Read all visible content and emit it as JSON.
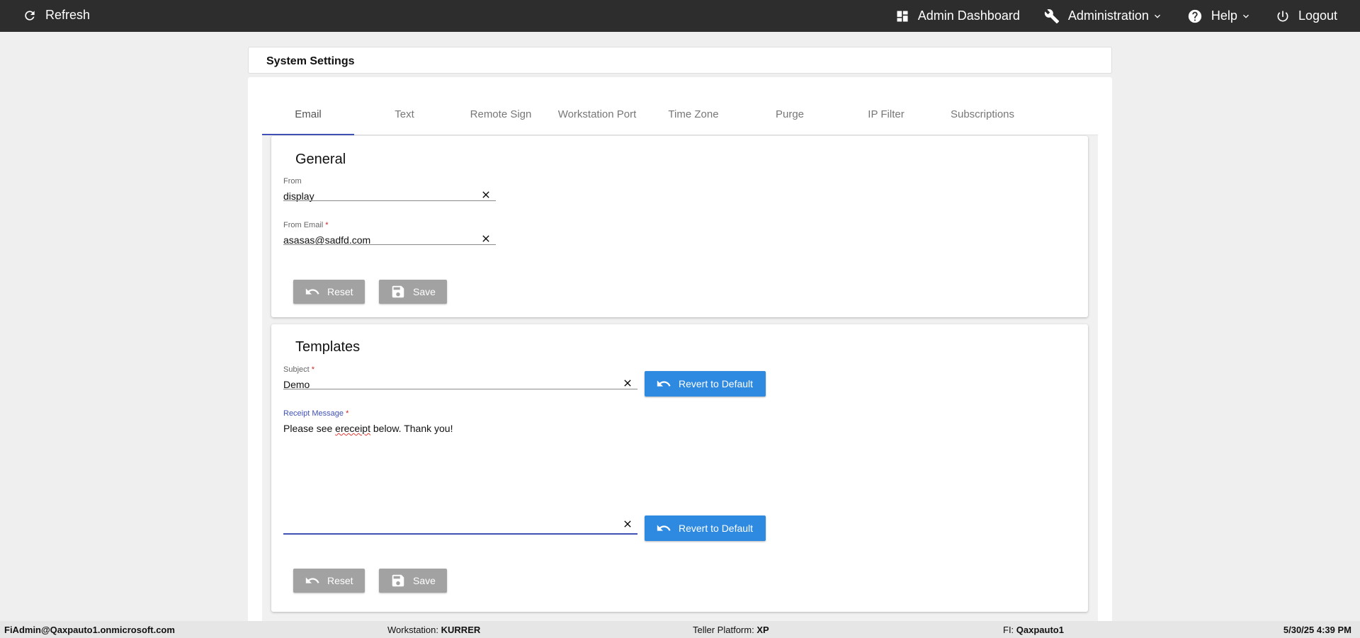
{
  "topbar": {
    "refresh_label": "Refresh",
    "admin_dashboard_label": "Admin Dashboard",
    "administration_label": "Administration",
    "help_label": "Help",
    "logout_label": "Logout",
    "icons": [
      "refresh-icon",
      "dashboard-icon",
      "wrench-icon",
      "help-icon",
      "power-icon",
      "chevron-down-icon"
    ]
  },
  "page": {
    "title": "System Settings"
  },
  "tabs": [
    {
      "label": "Email",
      "active": true
    },
    {
      "label": "Text"
    },
    {
      "label": "Remote Sign"
    },
    {
      "label": "Workstation Port"
    },
    {
      "label": "Time Zone"
    },
    {
      "label": "Purge"
    },
    {
      "label": "IP Filter"
    },
    {
      "label": "Subscriptions"
    }
  ],
  "general": {
    "title": "General",
    "from": {
      "label": "From",
      "value": "display"
    },
    "from_email": {
      "label": "From Email",
      "required_mark": "*",
      "value": "asasas@sadfd.com"
    },
    "reset_label": "Reset",
    "save_label": "Save"
  },
  "templates": {
    "title": "Templates",
    "subject": {
      "label": "Subject",
      "required_mark": "*",
      "value": "Demo"
    },
    "receipt_message": {
      "label": "Receipt Message",
      "required_mark": "*",
      "value_before": "Please see ",
      "value_misspelled": "ereceipt",
      "value_after": " below. Thank you!"
    },
    "revert_label": "Revert to Default",
    "reset_label": "Reset",
    "save_label": "Save"
  },
  "statusbar": {
    "user": "FiAdmin@Qaxpauto1.onmicrosoft.com",
    "workstation_label": "Workstation:",
    "workstation_value": "KURRER",
    "teller_label": "Teller Platform:",
    "teller_value": "XP",
    "fi_label": "FI:",
    "fi_value": "Qaxpauto1",
    "datetime": "5/30/25 4:39 PM"
  },
  "colors": {
    "topbar_bg": "#2d2d2d",
    "accent": "#3f51b5",
    "primary_button": "#2e8ae0",
    "disabled_button": "#a2a2a2",
    "required": "#c62828"
  }
}
